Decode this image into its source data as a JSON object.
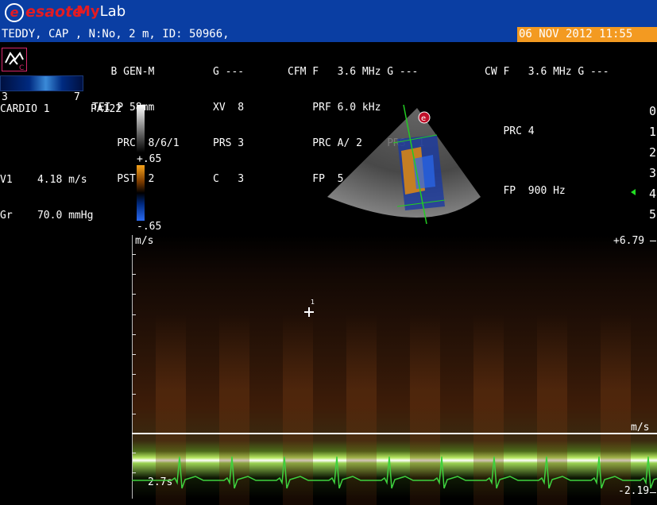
{
  "app": {
    "brand": "esaote",
    "product_prefix": "My",
    "product": "Lab",
    "brand_red": "#e31b23",
    "title_blue": "#0a3ea3",
    "date_orange": "#f39a21"
  },
  "patient": {
    "line": "TEDDY, CAP , N:No, 2 m, ID: 50966,",
    "date": "06 NOV 2012 11:55"
  },
  "params": {
    "b_col": [
      "   B GEN-M",
      "TEI P 58mm",
      "    PRC  8/6/1",
      "    PST  2"
    ],
    "b_col2": [
      "G ---",
      "XV  8",
      "PRS 3",
      "C   3"
    ],
    "cfm_col": [
      "CFM F   3.6 MHz G ---",
      "    PRF 6.0 kHz",
      "    PRC A/ 2    PRS  1",
      "    FP  5"
    ],
    "cw_col": [
      "CW F   3.6 MHz G ---",
      "",
      "   PRC 4",
      "",
      "   FP  900 Hz"
    ]
  },
  "probe_range": {
    "left": "3",
    "right": "7"
  },
  "preset": {
    "name": "CARDIO 1",
    "probe": "PA122"
  },
  "color_scale": {
    "top": "+.65",
    "bottom": "-.65"
  },
  "measurements": [
    {
      "label": "V1",
      "value": "4.18",
      "unit": "m/s"
    },
    {
      "label": "Gr",
      "value": "70.0",
      "unit": "mmHg"
    }
  ],
  "depth_ticks": [
    "0",
    "1",
    "2",
    "3",
    "4",
    "5"
  ],
  "spectrum": {
    "unit_top": "m/s",
    "max": "+6.79",
    "unit_baseline": "m/s",
    "min": "-2.19",
    "sweep": "2.7s"
  },
  "cursor": {
    "label": "1"
  }
}
